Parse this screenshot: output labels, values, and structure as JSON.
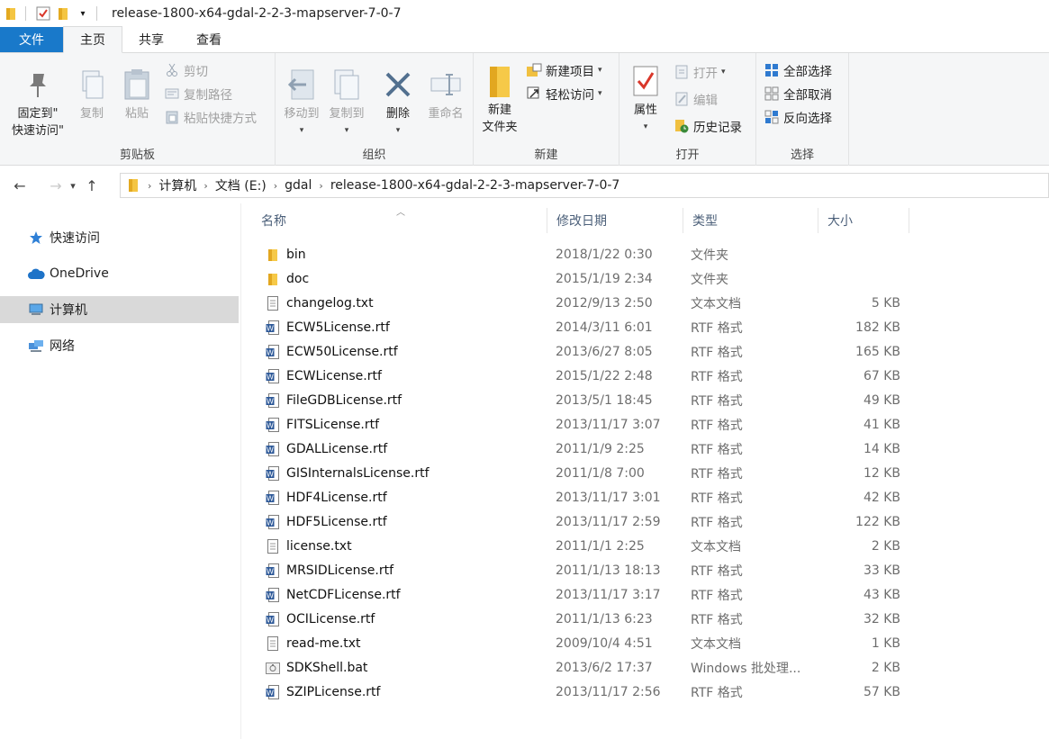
{
  "window": {
    "title": "release-1800-x64-gdal-2-2-3-mapserver-7-0-7"
  },
  "ribbon_tabs": [
    "文件",
    "主页",
    "共享",
    "查看"
  ],
  "ribbon": {
    "clipboard": {
      "label": "剪贴板",
      "pin_line1": "固定到\"",
      "pin_line2": "快速访问\"",
      "copy": "复制",
      "paste": "粘贴",
      "cut": "剪切",
      "copy_path": "复制路径",
      "paste_shortcut": "粘贴快捷方式"
    },
    "organize": {
      "label": "组织",
      "move_to": "移动到",
      "copy_to": "复制到",
      "delete": "删除",
      "rename": "重命名"
    },
    "new": {
      "label": "新建",
      "new_folder_line1": "新建",
      "new_folder_line2": "文件夹",
      "new_item": "新建项目",
      "easy_access": "轻松访问"
    },
    "open": {
      "label": "打开",
      "properties": "属性",
      "open": "打开",
      "edit": "编辑",
      "history": "历史记录"
    },
    "select": {
      "label": "选择",
      "select_all": "全部选择",
      "select_none": "全部取消",
      "invert": "反向选择"
    }
  },
  "breadcrumb": [
    "计算机",
    "文档 (E:)",
    "gdal",
    "release-1800-x64-gdal-2-2-3-mapserver-7-0-7"
  ],
  "sidebar": [
    {
      "label": "快速访问",
      "icon": "star-icon"
    },
    {
      "label": "OneDrive",
      "icon": "cloud-icon"
    },
    {
      "label": "计算机",
      "icon": "computer-icon",
      "selected": true
    },
    {
      "label": "网络",
      "icon": "network-icon"
    }
  ],
  "columns": {
    "name": "名称",
    "date": "修改日期",
    "type": "类型",
    "size": "大小"
  },
  "files": [
    {
      "name": "bin",
      "date": "2018/1/22 0:30",
      "type": "文件夹",
      "size": "",
      "icon": "folder"
    },
    {
      "name": "doc",
      "date": "2015/1/19 2:34",
      "type": "文件夹",
      "size": "",
      "icon": "folder"
    },
    {
      "name": "changelog.txt",
      "date": "2012/9/13 2:50",
      "type": "文本文档",
      "size": "5 KB",
      "icon": "txt"
    },
    {
      "name": "ECW5License.rtf",
      "date": "2014/3/11 6:01",
      "type": "RTF 格式",
      "size": "182 KB",
      "icon": "rtf"
    },
    {
      "name": "ECW50License.rtf",
      "date": "2013/6/27 8:05",
      "type": "RTF 格式",
      "size": "165 KB",
      "icon": "rtf"
    },
    {
      "name": "ECWLicense.rtf",
      "date": "2015/1/22 2:48",
      "type": "RTF 格式",
      "size": "67 KB",
      "icon": "rtf"
    },
    {
      "name": "FileGDBLicense.rtf",
      "date": "2013/5/1 18:45",
      "type": "RTF 格式",
      "size": "49 KB",
      "icon": "rtf"
    },
    {
      "name": "FITSLicense.rtf",
      "date": "2013/11/17 3:07",
      "type": "RTF 格式",
      "size": "41 KB",
      "icon": "rtf"
    },
    {
      "name": "GDALLicense.rtf",
      "date": "2011/1/9 2:25",
      "type": "RTF 格式",
      "size": "14 KB",
      "icon": "rtf"
    },
    {
      "name": "GISInternalsLicense.rtf",
      "date": "2011/1/8 7:00",
      "type": "RTF 格式",
      "size": "12 KB",
      "icon": "rtf"
    },
    {
      "name": "HDF4License.rtf",
      "date": "2013/11/17 3:01",
      "type": "RTF 格式",
      "size": "42 KB",
      "icon": "rtf"
    },
    {
      "name": "HDF5License.rtf",
      "date": "2013/11/17 2:59",
      "type": "RTF 格式",
      "size": "122 KB",
      "icon": "rtf"
    },
    {
      "name": "license.txt",
      "date": "2011/1/1 2:25",
      "type": "文本文档",
      "size": "2 KB",
      "icon": "txt"
    },
    {
      "name": "MRSIDLicense.rtf",
      "date": "2011/1/13 18:13",
      "type": "RTF 格式",
      "size": "33 KB",
      "icon": "rtf"
    },
    {
      "name": "NetCDFLicense.rtf",
      "date": "2013/11/17 3:17",
      "type": "RTF 格式",
      "size": "43 KB",
      "icon": "rtf"
    },
    {
      "name": "OCILicense.rtf",
      "date": "2011/1/13 6:23",
      "type": "RTF 格式",
      "size": "32 KB",
      "icon": "rtf"
    },
    {
      "name": "read-me.txt",
      "date": "2009/10/4 4:51",
      "type": "文本文档",
      "size": "1 KB",
      "icon": "txt"
    },
    {
      "name": "SDKShell.bat",
      "date": "2013/6/2 17:37",
      "type": "Windows 批处理...",
      "size": "2 KB",
      "icon": "bat"
    },
    {
      "name": "SZIPLicense.rtf",
      "date": "2013/11/17 2:56",
      "type": "RTF 格式",
      "size": "57 KB",
      "icon": "rtf"
    }
  ]
}
